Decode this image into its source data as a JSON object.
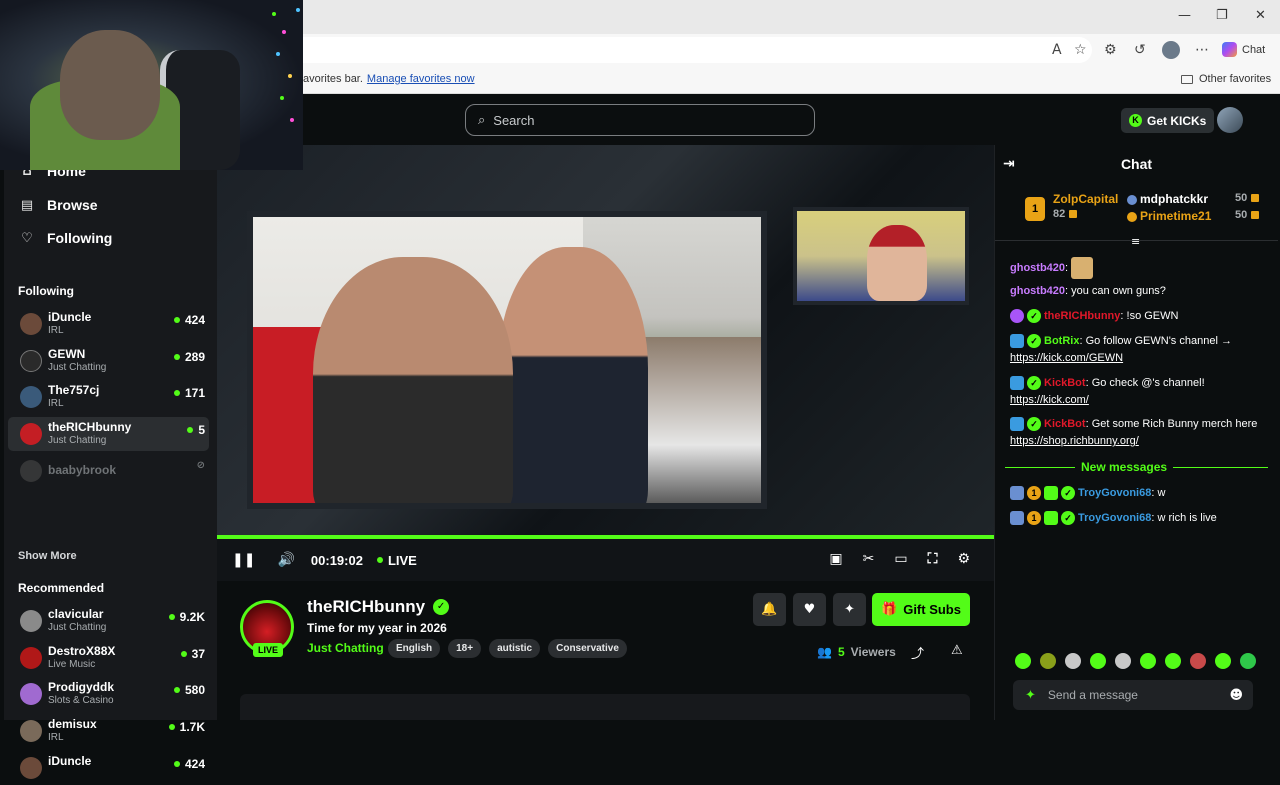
{
  "browser": {
    "window_controls": [
      "—",
      "❐",
      "✕"
    ],
    "favorites_message": "avorites bar.",
    "favorites_link": "Manage favorites now",
    "other_favorites": "Other favorites",
    "copilot_label": "Chat"
  },
  "topnav": {
    "search_placeholder": "Search",
    "get_kicks": "Get KICKs"
  },
  "sidebar": {
    "nav": [
      {
        "label": "Home",
        "icon": "home-icon"
      },
      {
        "label": "Browse",
        "icon": "browse-icon"
      },
      {
        "label": "Following",
        "icon": "heart-icon"
      }
    ],
    "following_heading": "Following",
    "following": [
      {
        "name": "iDuncle",
        "category": "IRL",
        "viewers": "424",
        "avatar_color": "#6b4a3a"
      },
      {
        "name": "GEWN",
        "category": "Just Chatting",
        "viewers": "289",
        "avatar_color": "#2a2a2a"
      },
      {
        "name": "The757cj",
        "category": "IRL",
        "viewers": "171",
        "avatar_color": "#3a5a7a"
      },
      {
        "name": "theRICHbunny",
        "category": "Just Chatting",
        "viewers": "5",
        "avatar_color": "#c41e24"
      },
      {
        "name": "baabybrook",
        "category": "",
        "viewers": "",
        "avatar_color": "#4a4a4a"
      }
    ],
    "show_more": "Show More",
    "recommended_heading": "Recommended",
    "recommended": [
      {
        "name": "clavicular",
        "category": "Just Chatting",
        "viewers": "9.2K",
        "avatar_color": "#8a8a8a"
      },
      {
        "name": "DestroX88X",
        "category": "Live Music",
        "viewers": "37",
        "avatar_color": "#b01818"
      },
      {
        "name": "Prodigyddk",
        "category": "Slots & Casino",
        "viewers": "580",
        "avatar_color": "#a06ad0"
      },
      {
        "name": "demisux",
        "category": "IRL",
        "viewers": "1.7K",
        "avatar_color": "#7a6a5a"
      },
      {
        "name": "iDuncle",
        "category": "",
        "viewers": "424",
        "avatar_color": "#6b4a3a"
      }
    ]
  },
  "player": {
    "time": "00:19:02",
    "live_label": "LIVE",
    "progress": 1.0
  },
  "stream": {
    "name": "theRICHbunny",
    "title": "Time for my year in 2026",
    "category": "Just Chatting",
    "tags": [
      "English",
      "18+",
      "autistic",
      "Conservative"
    ],
    "live_badge": "LIVE",
    "gift_subs": "Gift Subs",
    "viewer_count": "5",
    "viewer_label": "Viewers"
  },
  "chat": {
    "title": "Chat",
    "gifters": [
      {
        "rank": "1",
        "name": "ZolpCapital",
        "count": "82",
        "color": "#e9a316"
      },
      {
        "name": "mdphatckkr",
        "count": "50",
        "color": "#ffffff"
      },
      {
        "name": "Primetime21",
        "count": "50",
        "color": "#e9a316"
      }
    ],
    "messages": [
      {
        "user": "ghostb420",
        "color": "#c87cff",
        "text": "",
        "emote": true
      },
      {
        "user": "ghostb420",
        "color": "#c87cff",
        "text": "you can own guns?"
      },
      {
        "user": "theRICHbunny",
        "color": "#e0182a",
        "text": "!so GEWN"
      },
      {
        "user": "BotRix",
        "color": "#53fc18",
        "text": "Go follow GEWN's channel →",
        "link": "https://kick.com/GEWN"
      },
      {
        "user": "KickBot",
        "color": "#e0182a",
        "text": "Go check @'s channel!",
        "link": "https://kick.com/"
      },
      {
        "user": "KickBot",
        "color": "#e0182a",
        "text": "Get some Rich Bunny merch here",
        "link": "https://shop.richbunny.org/"
      },
      {
        "user": "TroyGovoni68",
        "color": "#3a9be0",
        "text": "w"
      },
      {
        "user": "TroyGovoni68",
        "color": "#3a9be0",
        "text": "w rich is live"
      }
    ],
    "new_messages": "New messages",
    "send_placeholder": "Send a message"
  }
}
